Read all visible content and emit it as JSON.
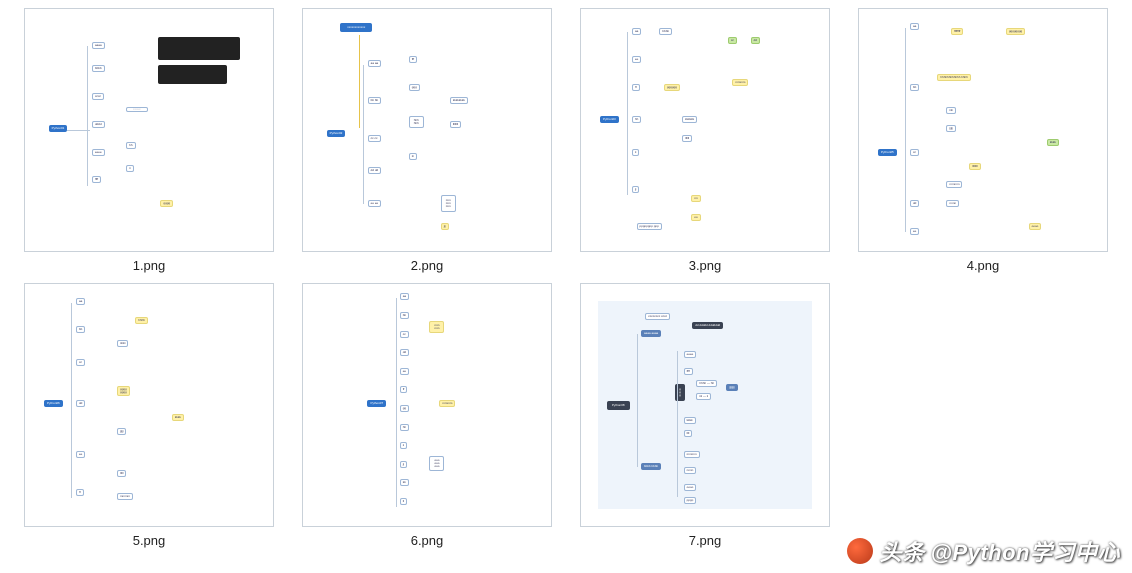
{
  "thumbnails": [
    {
      "filename": "1.png",
      "root_label": "Python01"
    },
    {
      "filename": "2.png",
      "root_label": "Python02"
    },
    {
      "filename": "3.png",
      "root_label": "Python03"
    },
    {
      "filename": "4.png",
      "root_label": "Python05"
    },
    {
      "filename": "5.png",
      "root_label": "Python06"
    },
    {
      "filename": "6.png",
      "root_label": "Python07"
    },
    {
      "filename": "7.png",
      "root_label": "Python08"
    }
  ],
  "watermark": {
    "prefix": "头条",
    "handle": "@Python学习中心"
  }
}
